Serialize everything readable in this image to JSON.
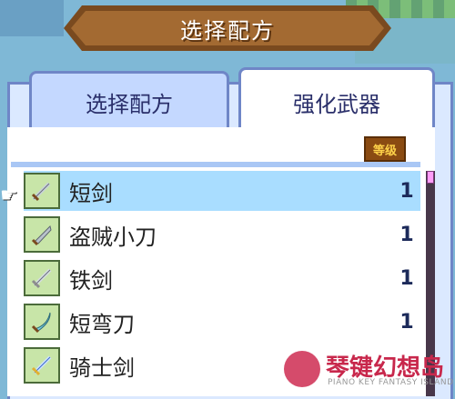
{
  "title": "选择配方",
  "tabs": [
    {
      "label": "选择配方",
      "active": false
    },
    {
      "label": "强化武器",
      "active": true
    }
  ],
  "column_header": "等级",
  "items": [
    {
      "name": "短剑",
      "level": "1",
      "icon": "short-sword-icon",
      "selected": true
    },
    {
      "name": "盗贼小刀",
      "level": "1",
      "icon": "thief-dagger-icon",
      "selected": false
    },
    {
      "name": "铁剑",
      "level": "1",
      "icon": "iron-sword-icon",
      "selected": false
    },
    {
      "name": "短弯刀",
      "level": "1",
      "icon": "short-scimitar-icon",
      "selected": false
    },
    {
      "name": "骑士剑",
      "level": "",
      "icon": "knight-sword-icon",
      "selected": false
    }
  ],
  "watermark": {
    "title": "琴键幻想岛",
    "subtitle": "PIANO KEY FANTASY ISLAND"
  },
  "colors": {
    "selection": "#a9ddff",
    "tab_border": "#6f86c7",
    "badge": "#8a4b12"
  }
}
